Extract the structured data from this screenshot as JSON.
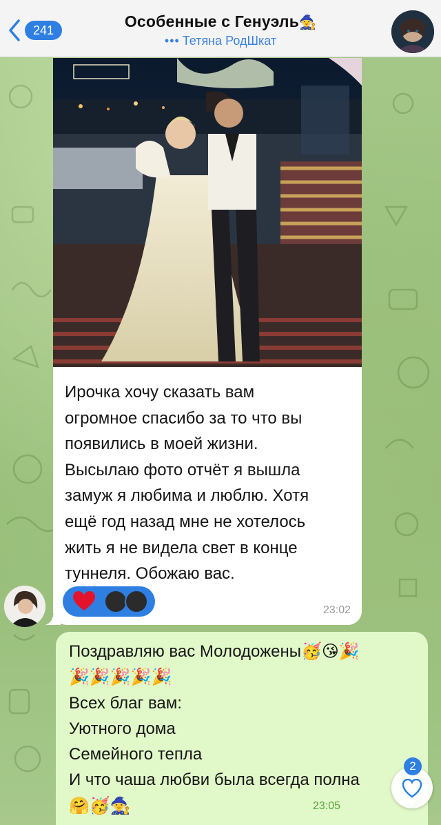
{
  "header": {
    "back_count": "241",
    "title": "Особенные с Генуэль",
    "title_emoji": "🧙",
    "subtitle_dots": "•••",
    "subtitle": "Тетяна РодШкат",
    "avatar_icon": "group-avatar-fantasy-portrait"
  },
  "incoming": {
    "photo_icon": "wedding-couple-photo",
    "text": "Ирочка хочу сказать вам огромное спасибо за то что вы появились в моей жизни. Высылаю фото отчёт я вышла замуж я любима и люблю. Хотя ещё год назад мне не хотелось жить я не видела свет в конце туннеля. Обожаю вас.",
    "text_lines": [
      "Ирочка хочу сказать вам",
      "огромное спасибо за то что вы",
      "появились в моей жизни.",
      "Высылаю фото отчёт я вышла",
      "замуж я любима и люблю. Хотя",
      "ещё год назад мне не хотелось",
      "жить я не видела свет в конце",
      "туннеля. Обожаю вас."
    ],
    "reaction_emoji": "❤️",
    "time": "23:02",
    "sender_avatar_icon": "sender-avatar-woman"
  },
  "outgoing": {
    "lines": [
      "Поздравляю вас Молодожены🥳😘🎉",
      "🎉🎉🎉🎉🎉",
      "Всех благ вам:",
      "Уютного дома",
      "Семейного тепла",
      "И что чаша любви была всегда полна",
      "🤗🥳🧙"
    ],
    "time": "23:05",
    "status_icon": "double-check-icon"
  },
  "floating": {
    "like_count": "2",
    "icon": "heart-outline-icon"
  },
  "colors": {
    "accent": "#2f7fe3",
    "incoming_bubble": "#ffffff",
    "outgoing_bubble": "#e1f8c8",
    "background": "#a7c98a"
  }
}
